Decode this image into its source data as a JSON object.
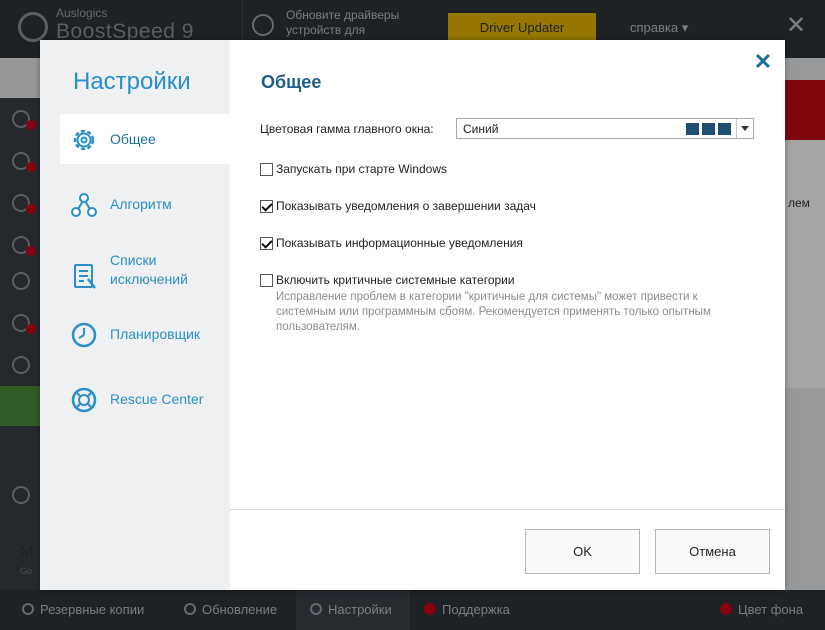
{
  "background_app": {
    "logo_small": "Auslogics",
    "logo_big": "BoostSpeed 9",
    "promo_text": "Обновите драйверы устройств для",
    "driver_button": "Driver Updater",
    "help_menu": "справка",
    "help_arrow": "▾",
    "close_glyph": "✕",
    "main_partial_text": "лем",
    "left_partial_title": "M",
    "left_partial_sub": "Go",
    "bottom_bar": [
      {
        "label": "Резервные копии",
        "icon": "undo-icon"
      },
      {
        "label": "Обновление",
        "icon": "refresh-icon"
      },
      {
        "label": "Настройки",
        "icon": "gear-icon"
      },
      {
        "label": "Поддержка",
        "icon": "help-icon"
      },
      {
        "label": "Цвет фона",
        "icon": "palette-icon"
      }
    ]
  },
  "dialog": {
    "title": "Настройки",
    "close_glyph": "✕",
    "nav": [
      {
        "label": "Общее",
        "icon": "gear-icon",
        "active": true
      },
      {
        "label": "Алгоритм",
        "icon": "algorithm-icon",
        "active": false
      },
      {
        "label": "Списки исключений",
        "icon": "list-icon",
        "active": false
      },
      {
        "label": "Планировщик",
        "icon": "clock-icon",
        "active": false
      },
      {
        "label": "Rescue Center",
        "icon": "lifebuoy-icon",
        "active": false
      }
    ],
    "section_title": "Общее",
    "color_scheme_label": "Цветовая гамма главного окна:",
    "color_scheme_value": "Синий",
    "color_swatch": "#1e4f73",
    "options": [
      {
        "label": "Запускать при старте Windows",
        "checked": false
      },
      {
        "label": "Показывать уведомления о завершении задач",
        "checked": true
      },
      {
        "label": "Показывать информационные уведомления",
        "checked": true
      },
      {
        "label": "Включить критичные системные категории",
        "checked": false
      }
    ],
    "hint": "Исправление проблем в категории \"критичные для системы\" может привести к системным или программным сбоям. Рекомендуется применять только опытным пользователям.",
    "ok_button": "OK",
    "cancel_button": "Отмена"
  },
  "colors": {
    "accent": "#2b8fc7",
    "section_title": "#1e5f8a",
    "warning_badge": "#d0021b",
    "driver_button": "#e7b800"
  }
}
